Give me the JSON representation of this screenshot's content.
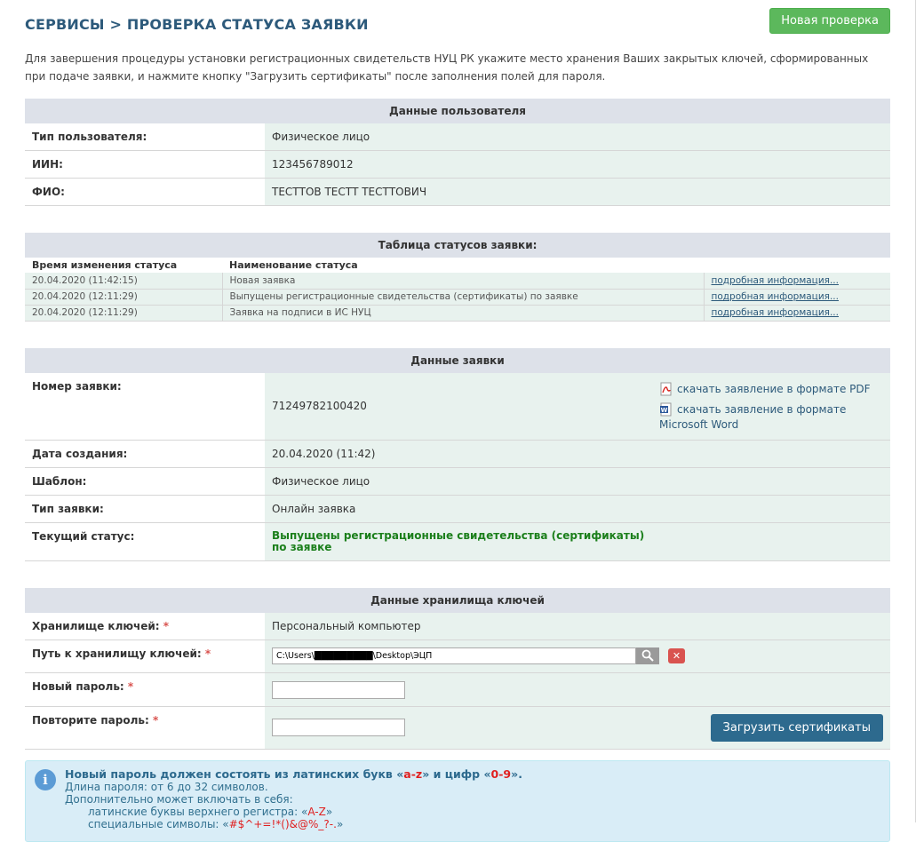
{
  "header": {
    "title": "СЕРВИСЫ > ПРОВЕРКА СТАТУСА ЗАЯВКИ",
    "new_check_label": "Новая проверка"
  },
  "intro": "Для завершения процедуры установки регистрационных свидетельств НУЦ РК укажите место хранения Ваших закрытых ключей, сформированных при подаче заявки, и нажмите кнопку \"Загрузить сертификаты\" после заполнения полей для пароля.",
  "user_data": {
    "title": "Данные пользователя",
    "rows": [
      {
        "label": "Тип пользователя:",
        "value": "Физическое лицо"
      },
      {
        "label": "ИИН:",
        "value": "123456789012"
      },
      {
        "label": "ФИО:",
        "value": "ТЕСТТОВ ТЕСТТ ТЕСТТОВИЧ"
      }
    ]
  },
  "status_table": {
    "title": "Таблица статусов заявки:",
    "col_time": "Время изменения статуса",
    "col_name": "Наименование статуса",
    "rows": [
      {
        "time": "20.04.2020 (11:42:15)",
        "name": "Новая заявка",
        "link": "подробная информация..."
      },
      {
        "time": "20.04.2020 (12:11:29)",
        "name": "Выпущены регистрационные свидетельства (сертификаты) по заявке",
        "link": "подробная информация..."
      },
      {
        "time": "20.04.2020 (12:11:29)",
        "name": "Заявка на подписи в ИС НУЦ",
        "link": "подробная информация..."
      }
    ]
  },
  "request_data": {
    "title": "Данные заявки",
    "number_label": "Номер заявки:",
    "number_value": "71249782100420",
    "download_pdf": "скачать заявление в формате PDF",
    "download_word": "скачать заявление в формате Microsoft Word",
    "created_label": "Дата создания:",
    "created_value": "20.04.2020 (11:42)",
    "template_label": "Шаблон:",
    "template_value": "Физическое лицо",
    "type_label": "Тип заявки:",
    "type_value": "Онлайн заявка",
    "status_label": "Текущий статус:",
    "status_value": "Выпущены регистрационные свидетельства (сертификаты) по заявке"
  },
  "keystore": {
    "title": "Данные хранилища ключей",
    "storage_label": "Хранилище ключей:",
    "storage_value": "Персональный компьютер",
    "path_label": "Путь к хранилищу ключей:",
    "path_value": "C:\\Users\\█████████\\Desktop\\ЭЦП",
    "new_pwd_label": "Новый пароль:",
    "repeat_pwd_label": "Повторите пароль:",
    "required_mark": "*",
    "upload_label": "Загрузить сертификаты"
  },
  "info": {
    "line1_a": "Новый пароль должен состоять из латинских букв «",
    "line1_b": "a-z",
    "line1_c": "» и цифр «",
    "line1_d": "0-9",
    "line1_e": "».",
    "line2": "Длина пароля: от 6 до 32 символов.",
    "line3": "Дополнительно может включать в себя:",
    "line4_a": "латинские буквы верхнего регистра: «",
    "line4_b": "A-Z",
    "line4_c": "»",
    "line5_a": "специальные символы: «",
    "line5_b": "#$^+=!*()&@%_?-.",
    "line5_c": "»"
  }
}
